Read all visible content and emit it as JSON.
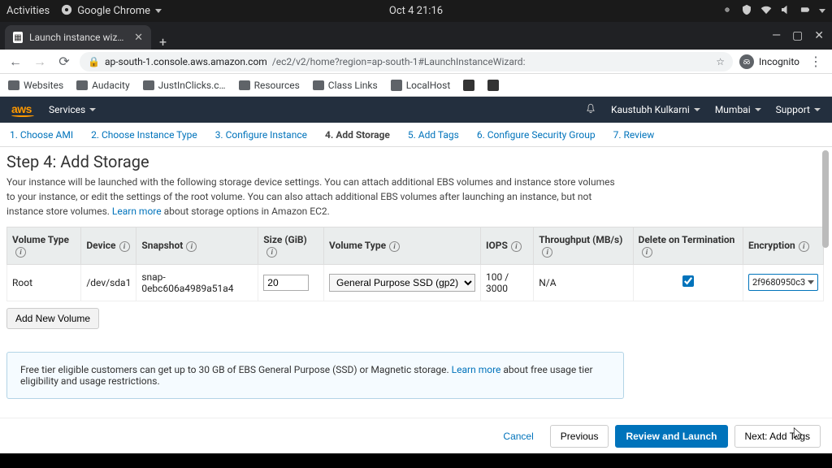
{
  "gnome": {
    "activities": "Activities",
    "app": "Google Chrome",
    "clock": "Oct 4  21:16"
  },
  "tab": {
    "title": "Launch instance wizard | E"
  },
  "toolbar": {
    "url_host": "ap-south-1.console.aws.amazon.com",
    "url_path": "/ec2/v2/home?region=ap-south-1#LaunchInstanceWizard:",
    "incognito": "Incognito"
  },
  "bookmarks": {
    "items": [
      "Websites",
      "Audacity",
      "JustInClicks.c…",
      "Resources",
      "Class Links",
      "LocalHost"
    ]
  },
  "aws": {
    "services": "Services",
    "user": "Kaustubh Kulkarni",
    "region": "Mumbai",
    "support": "Support"
  },
  "wizard": {
    "steps": [
      "1. Choose AMI",
      "2. Choose Instance Type",
      "3. Configure Instance",
      "4. Add Storage",
      "5. Add Tags",
      "6. Configure Security Group",
      "7. Review"
    ],
    "active_index": 3,
    "title": "Step 4: Add Storage",
    "desc_a": "Your instance will be launched with the following storage device settings. You can attach additional EBS volumes and instance store volumes to your instance, or edit the settings of the root volume. You can also attach additional EBS volumes after launching an instance, but not instance store volumes. ",
    "learn_more": "Learn more",
    "desc_b": " about storage options in Amazon EC2."
  },
  "table": {
    "headers": {
      "vol_type": "Volume Type",
      "device": "Device",
      "snapshot": "Snapshot",
      "size": "Size (GiB)",
      "vt2": "Volume Type",
      "iops": "IOPS",
      "throughput": "Throughput (MB/s)",
      "dot": "Delete on Termination",
      "enc": "Encryption"
    },
    "row": {
      "vol_type": "Root",
      "device": "/dev/sda1",
      "snapshot": "snap-0ebc606a4989a51a4",
      "size": "20",
      "vt2": "General Purpose SSD (gp2)",
      "iops": "100 / 3000",
      "throughput": "N/A",
      "enc": "2f9680950c3"
    },
    "add_volume": "Add New Volume"
  },
  "free_tier": {
    "text_a": "Free tier eligible customers can get up to 30 GB of EBS General Purpose (SSD) or Magnetic storage. ",
    "link": "Learn more",
    "text_b": " about free usage tier eligibility and usage restrictions."
  },
  "footer": {
    "cancel": "Cancel",
    "previous": "Previous",
    "review": "Review and Launch",
    "next": "Next: Add Tags"
  }
}
